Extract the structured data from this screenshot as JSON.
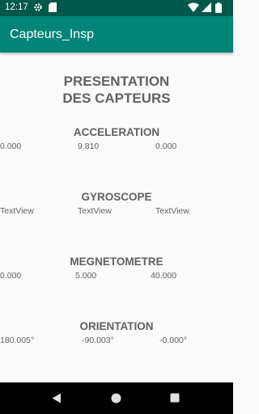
{
  "status_bar": {
    "time": "12:17",
    "icons": [
      "gear-icon",
      "sd-card-icon",
      "wifi-icon",
      "cell-signal-icon",
      "battery-icon"
    ]
  },
  "app_bar": {
    "title": "Capteurs_Insp"
  },
  "main": {
    "title_line1": "PRESENTATION",
    "title_line2": "DES CAPTEURS",
    "sections": [
      {
        "title": "ACCELERATION",
        "values": [
          "0.000",
          "9.810",
          "0.000"
        ]
      },
      {
        "title": "GYROSCOPE",
        "values": [
          "TextView",
          "TextView",
          "TextView"
        ]
      },
      {
        "title": "MEGNETOMETRE",
        "values": [
          "0.000",
          "5.000",
          "40.000"
        ]
      },
      {
        "title": "ORIENTATION",
        "values": [
          "180.005°",
          "-90.003°",
          "-0.000°"
        ]
      }
    ]
  },
  "nav_bar": {
    "icons": [
      "back-icon",
      "home-icon",
      "recents-icon"
    ]
  },
  "colors": {
    "primary": "#008577",
    "primary_dark": "#00574b",
    "text": "#616161",
    "background": "#fafafa"
  }
}
